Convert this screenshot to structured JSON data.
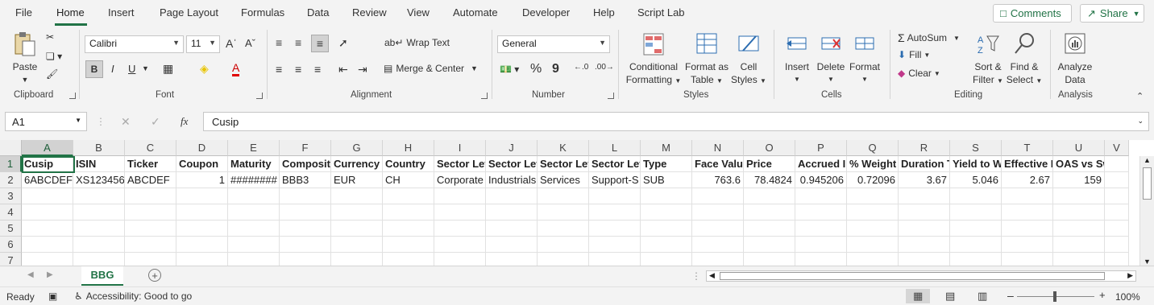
{
  "menu": {
    "tabs": [
      "File",
      "Home",
      "Insert",
      "Page Layout",
      "Formulas",
      "Data",
      "Review",
      "View",
      "Automate",
      "Developer",
      "Help",
      "Script Lab"
    ],
    "comments_label": "Comments",
    "share_label": "Share"
  },
  "ribbon": {
    "clipboard": {
      "paste_label": "Paste",
      "group_label": "Clipboard"
    },
    "font": {
      "font_name": "Calibri",
      "font_size": "11",
      "group_label": "Font",
      "bold": "B",
      "italic": "I",
      "underline": "U"
    },
    "alignment": {
      "wrap_text": "Wrap Text",
      "merge_center": "Merge & Center",
      "group_label": "Alignment"
    },
    "number": {
      "format": "General",
      "percent": "%",
      "comma": "9",
      "group_label": "Number"
    },
    "styles": {
      "conditional_formatting": "Conditional",
      "conditional_formatting_2": "Formatting",
      "format_as_table": "Format as",
      "format_as_table_2": "Table",
      "cell_styles": "Cell",
      "cell_styles_2": "Styles",
      "group_label": "Styles"
    },
    "cells": {
      "insert": "Insert",
      "delete": "Delete",
      "format": "Format",
      "group_label": "Cells"
    },
    "editing": {
      "autosum": "AutoSum",
      "fill": "Fill",
      "clear": "Clear",
      "sort_filter": "Sort &",
      "sort_filter_2": "Filter",
      "find_select": "Find &",
      "find_select_2": "Select",
      "group_label": "Editing"
    },
    "analysis": {
      "analyze": "Analyze",
      "analyze_2": "Data",
      "group_label": "Analysis"
    }
  },
  "formula_bar": {
    "name_box": "A1",
    "fx": "fx",
    "value": "Cusip"
  },
  "grid": {
    "columns": [
      "A",
      "B",
      "C",
      "D",
      "E",
      "F",
      "G",
      "H",
      "I",
      "J",
      "K",
      "L",
      "M",
      "N",
      "O",
      "P",
      "Q",
      "R",
      "S",
      "T",
      "U",
      "V"
    ],
    "rows": [
      "1",
      "2",
      "3",
      "4",
      "5",
      "6",
      "7"
    ],
    "header_row": [
      "Cusip",
      "ISIN",
      "Ticker",
      "Coupon",
      "Maturity",
      "Composite",
      "Currency",
      "Country",
      "Sector Level",
      "Sector Level",
      "Sector Level",
      "Sector Level",
      "Type",
      "Face Value",
      "Price",
      "Accrued Interest",
      "% Weight",
      "Duration T",
      "Yield to W",
      "Effective D",
      "OAS vs Swap",
      ""
    ],
    "data_row": [
      "6ABCDEFG",
      "XS1234567",
      "ABCDEF",
      "1",
      "########",
      "BBB3",
      "EUR",
      "CH",
      "Corporate",
      "Industrials",
      "Services",
      "Support-S",
      "SUB",
      "763.6",
      "78.4824",
      "0.945206",
      "0.72096",
      "3.67",
      "5.046",
      "2.67",
      "159",
      ""
    ]
  },
  "sheets": {
    "active": "BBG"
  },
  "status": {
    "ready": "Ready",
    "accessibility": "Accessibility: Good to go",
    "zoom": "100%"
  },
  "colors": {
    "accent": "#217346"
  }
}
